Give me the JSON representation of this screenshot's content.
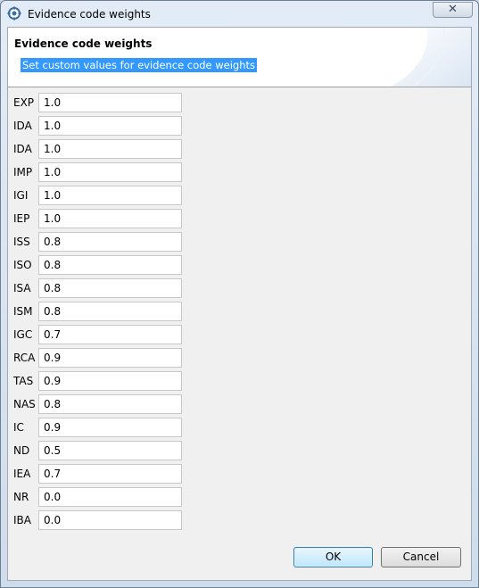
{
  "window": {
    "title": "Evidence code weights",
    "close_glyph": "✕"
  },
  "header": {
    "title": "Evidence code weights",
    "description": "Set custom values for evidence code weights"
  },
  "rows": [
    {
      "code": "EXP",
      "value": "1.0"
    },
    {
      "code": "IDA",
      "value": "1.0"
    },
    {
      "code": "IDA",
      "value": "1.0"
    },
    {
      "code": "IMP",
      "value": "1.0"
    },
    {
      "code": "IGI",
      "value": "1.0"
    },
    {
      "code": "IEP",
      "value": "1.0"
    },
    {
      "code": "ISS",
      "value": "0.8"
    },
    {
      "code": "ISO",
      "value": "0.8"
    },
    {
      "code": "ISA",
      "value": "0.8"
    },
    {
      "code": "ISM",
      "value": "0.8"
    },
    {
      "code": "IGC",
      "value": "0.7"
    },
    {
      "code": "RCA",
      "value": "0.9"
    },
    {
      "code": "TAS",
      "value": "0.9"
    },
    {
      "code": "NAS",
      "value": "0.8"
    },
    {
      "code": "IC",
      "value": "0.9"
    },
    {
      "code": "ND",
      "value": "0.5"
    },
    {
      "code": "IEA",
      "value": "0.7"
    },
    {
      "code": "NR",
      "value": "0.0"
    },
    {
      "code": "IBA",
      "value": "0.0"
    }
  ],
  "buttons": {
    "ok": "OK",
    "cancel": "Cancel"
  },
  "colors": {
    "selection": "#3399ff",
    "ok_border": "#3c7fb1"
  },
  "icons": {
    "app": "gear-icon",
    "close": "close-icon"
  }
}
